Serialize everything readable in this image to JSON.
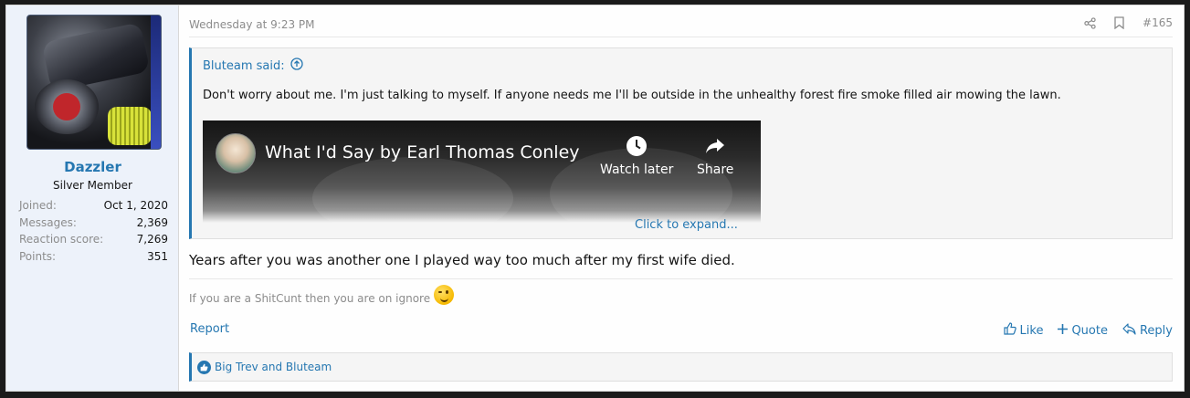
{
  "user": {
    "name": "Dazzler",
    "title": "Silver Member",
    "stats": [
      {
        "label": "Joined:",
        "value": "Oct 1, 2020"
      },
      {
        "label": "Messages:",
        "value": "2,369"
      },
      {
        "label": "Reaction score:",
        "value": "7,269"
      },
      {
        "label": "Points:",
        "value": "351"
      }
    ]
  },
  "post": {
    "date": "Wednesday at 9:23 PM",
    "number": "#165",
    "quote": {
      "author_label": "Bluteam said:",
      "text": "Don't worry about me. I'm just talking to myself. If anyone needs me I'll be outside in the unhealthy forest fire smoke filled air mowing the lawn.",
      "video_title": "What I'd Say by Earl Thomas Conley",
      "watch_later_label": "Watch later",
      "share_label": "Share",
      "expand_label": "Click to expand..."
    },
    "body": "Years after you was another one I played way too much after my first wife died.",
    "signature": "If you are a ShitCunt then you are on ignore",
    "report_label": "Report",
    "like_label": "Like",
    "quote_label": "Quote",
    "reply_label": "Reply",
    "reactions_text": "Big Trev and Bluteam"
  },
  "icons": [
    "share-icon",
    "bookmark-icon",
    "arrow-up-circle-icon",
    "clock-icon",
    "share-arrow-icon",
    "thumbs-up-icon",
    "plus-icon",
    "reply-icon",
    "wink-emoji-icon"
  ],
  "colors": {
    "accent": "#2577b1",
    "sidebar_bg": "#edf2fa",
    "muted": "#8c8c8c"
  }
}
